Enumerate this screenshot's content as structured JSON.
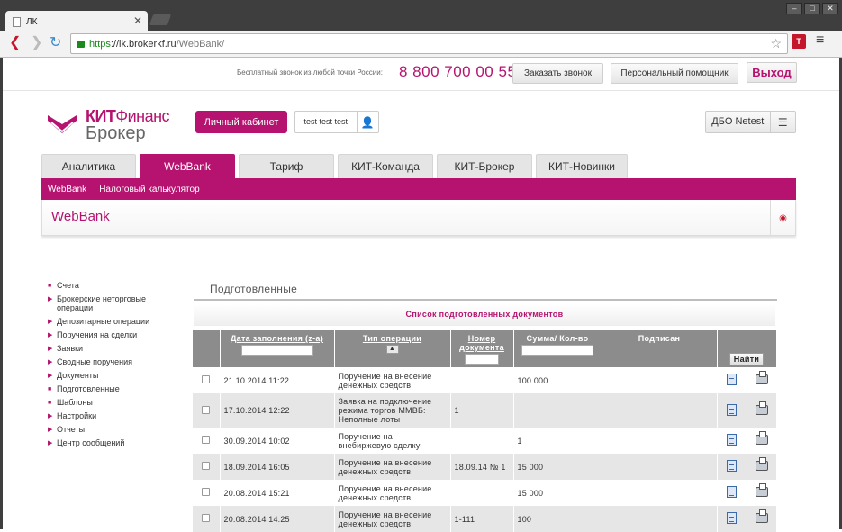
{
  "browser": {
    "tab_title": "ЛК",
    "url_https": "https",
    "url_host": "://lk.brokerkf.ru",
    "url_path": "/WebBank/",
    "extension_label": "Т"
  },
  "header": {
    "free_call_text": "Бесплатный звонок из любой точки России:",
    "phone": "8 800 700 00 55",
    "order_call": "Заказать звонок",
    "personal_assistant": "Персональный помощник",
    "logout": "Выход"
  },
  "brand": {
    "logo_line1_bold": "КИТ",
    "logo_line1_rest": "Финанс",
    "logo_line2": "Брокер",
    "cabinet_label": "Личный кабинет",
    "user_name": "test test test",
    "dbo_label": "ДБО Netest"
  },
  "nav": {
    "tabs": [
      "Аналитика",
      "WebBank",
      "Тариф",
      "КИТ-Команда",
      "КИТ-Брокер",
      "КИТ-Новинки"
    ],
    "active_tab": "WebBank",
    "sub_items": [
      "WebBank",
      "Налоговый калькулятор"
    ]
  },
  "page_title": "WebBank",
  "sidebar": {
    "items": [
      "Счета",
      "Брокерские неторговые операции",
      "Депозитарные операции",
      "Поручения на сделки",
      "Заявки",
      "Сводные поручения",
      "Документы",
      "Подготовленные",
      "Шаблоны",
      "Настройки",
      "Отчеты",
      "Центр сообщений"
    ]
  },
  "section": {
    "title": "Подготовленные",
    "list_header": "Список подготовленных документов"
  },
  "table": {
    "headers": {
      "date": "Дата заполнения (z-a)",
      "type": "Тип операции",
      "number": "Номер документа",
      "amount": "Сумма/ Кол-во",
      "signed": "Подписан",
      "find": "Найти"
    },
    "sort_symbol": "▲",
    "rows": [
      {
        "date": "21.10.2014 11:22",
        "type": "Поручение на внесение денежных средств",
        "number": "",
        "amount": "100 000",
        "signed": ""
      },
      {
        "date": "17.10.2014 12:22",
        "type": "Заявка на подключение режима торгов ММВБ: Неполные лоты",
        "number": "1",
        "amount": "",
        "signed": ""
      },
      {
        "date": "30.09.2014 10:02",
        "type": "Поручение на внебиржевую сделку",
        "number": "",
        "amount": "1",
        "signed": ""
      },
      {
        "date": "18.09.2014 16:05",
        "type": "Поручение на внесение денежных средств",
        "number": "18.09.14 № 1",
        "amount": "15 000",
        "signed": ""
      },
      {
        "date": "20.08.2014 15:21",
        "type": "Поручение на внесение денежных средств",
        "number": "",
        "amount": "15 000",
        "signed": ""
      },
      {
        "date": "20.08.2014 14:25",
        "type": "Поручение на внесение денежных средств",
        "number": "1-111",
        "amount": "100",
        "signed": ""
      }
    ]
  },
  "colors": {
    "brand": "#b5136f",
    "header_gray": "#8c8c8c",
    "row_alt": "#e6e6e6"
  }
}
